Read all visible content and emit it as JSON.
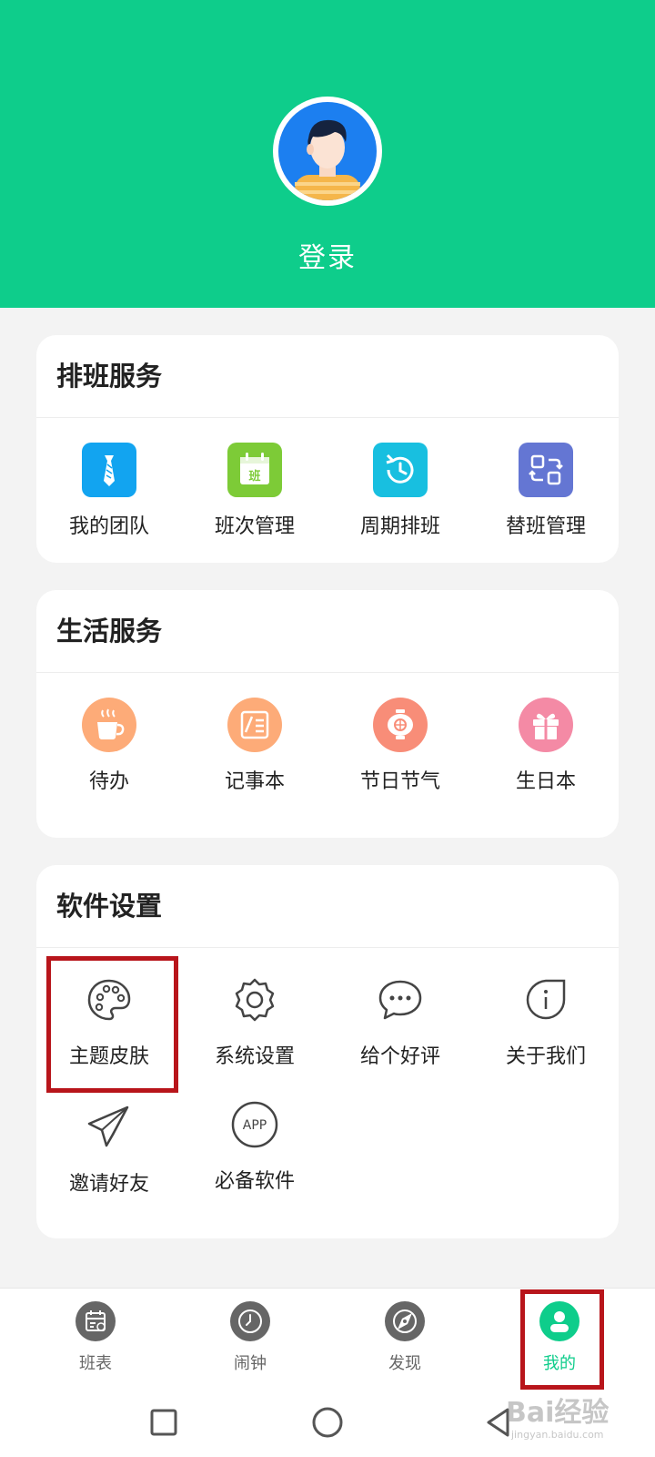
{
  "header": {
    "login_label": "登录",
    "background_color": "#0ecd8b"
  },
  "sections": [
    {
      "title": "排班服务",
      "items": [
        {
          "label": "我的团队",
          "icon": "tie-icon",
          "color": "#12a4f0"
        },
        {
          "label": "班次管理",
          "icon": "shift-calendar-icon",
          "color": "#7dcb37",
          "icon_text": "班"
        },
        {
          "label": "周期排班",
          "icon": "cycle-clock-icon",
          "color": "#18bfe0"
        },
        {
          "label": "替班管理",
          "icon": "swap-icon",
          "color": "#6476d3"
        }
      ]
    },
    {
      "title": "生活服务",
      "items": [
        {
          "label": "待办",
          "icon": "coffee-cup-icon",
          "color": "#fdab78"
        },
        {
          "label": "记事本",
          "icon": "notepad-icon",
          "color": "#fdab78"
        },
        {
          "label": "节日节气",
          "icon": "lantern-icon",
          "color": "#f88d78"
        },
        {
          "label": "生日本",
          "icon": "gift-icon",
          "color": "#f48aa5"
        }
      ]
    },
    {
      "title": "软件设置",
      "items": [
        {
          "label": "主题皮肤",
          "icon": "palette-icon"
        },
        {
          "label": "系统设置",
          "icon": "gear-icon"
        },
        {
          "label": "给个好评",
          "icon": "chat-bubble-icon"
        },
        {
          "label": "关于我们",
          "icon": "info-icon"
        },
        {
          "label": "邀请好友",
          "icon": "paper-plane-icon"
        },
        {
          "label": "必备软件",
          "icon": "app-icon",
          "icon_text": "APP"
        }
      ]
    }
  ],
  "tabbar": [
    {
      "label": "班表",
      "icon": "schedule-tab-icon",
      "active": false
    },
    {
      "label": "闹钟",
      "icon": "alarm-tab-icon",
      "active": false
    },
    {
      "label": "发现",
      "icon": "discover-tab-icon",
      "active": false
    },
    {
      "label": "我的",
      "icon": "profile-tab-icon",
      "active": true
    }
  ],
  "colors": {
    "accent": "#0ecd8b",
    "highlight": "#b8151b",
    "tab_inactive": "#666666"
  },
  "watermark": {
    "text": "Bai经验",
    "subtext": "jingyan.baidu.com"
  }
}
